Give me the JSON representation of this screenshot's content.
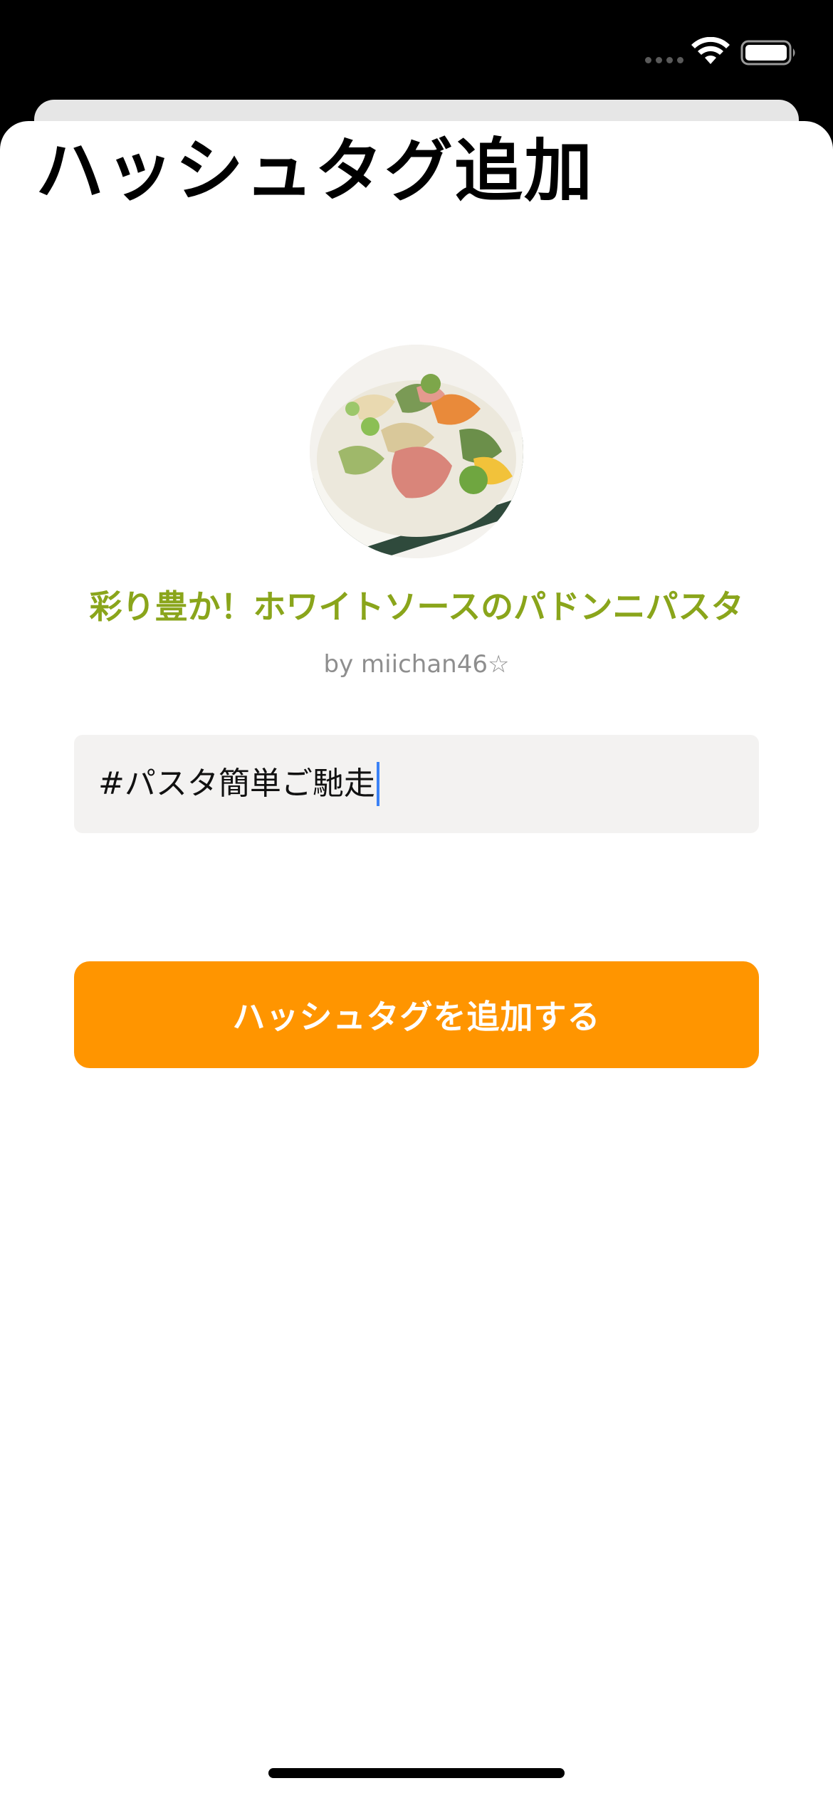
{
  "status_bar": {
    "wifi_icon": "wifi-icon",
    "battery_icon": "battery-icon"
  },
  "page": {
    "title": "ハッシュタグ追加"
  },
  "recipe": {
    "photo_icon": "pasta-dish-photo",
    "title": "彩り豊か！ホワイトソースのパドンニパスタ",
    "author": "by miichan46☆"
  },
  "hashtag_input": {
    "value": "#パスタ簡単ご馳走"
  },
  "actions": {
    "add_label": "ハッシュタグを追加する"
  },
  "colors": {
    "accent_orange": "#ff9500",
    "recipe_title_green": "#8aa51b",
    "author_gray": "#8e8e8e",
    "input_background": "#f3f2f1"
  }
}
